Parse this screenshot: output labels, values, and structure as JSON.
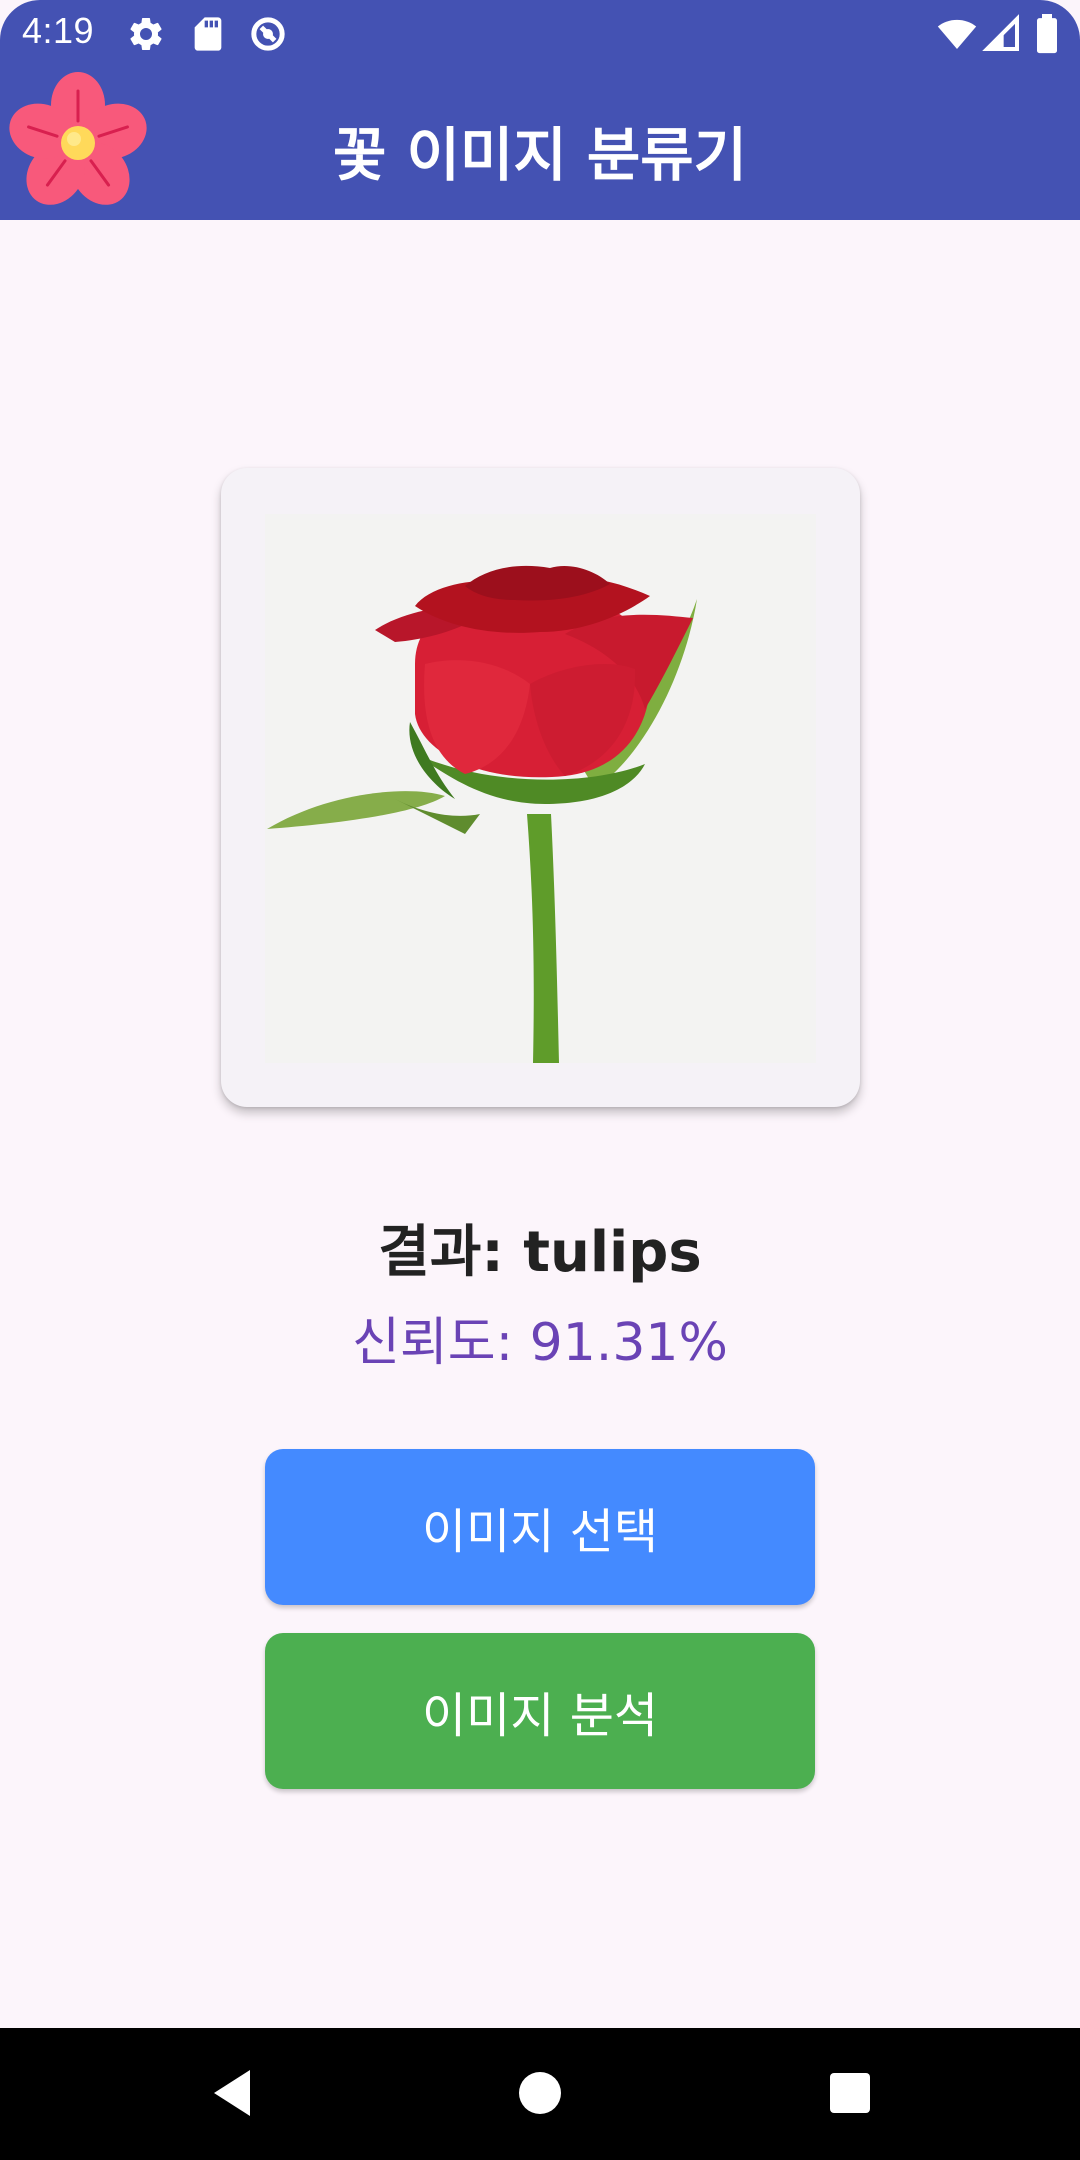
{
  "status_bar": {
    "time": "4:19",
    "left_icons": [
      "gear-icon",
      "sd-card-icon",
      "data-saver-icon"
    ],
    "right_icons": [
      "wifi-icon",
      "cell-signal-icon",
      "battery-icon"
    ]
  },
  "app_bar": {
    "title": "꽃 이미지 분류기",
    "logo_icon": "flower-logo-icon",
    "color": "#4452b3"
  },
  "image_card": {
    "image": "red-rose-photo"
  },
  "result": {
    "label": "결과: tulips",
    "confidence": "신뢰도: 91.31%"
  },
  "buttons": {
    "select_label": "이미지 선택",
    "analyze_label": "이미지 분석",
    "select_color": "#448aff",
    "analyze_color": "#4caf50"
  },
  "nav_bar": {
    "icons": [
      "back-icon",
      "home-icon",
      "recents-icon"
    ]
  }
}
